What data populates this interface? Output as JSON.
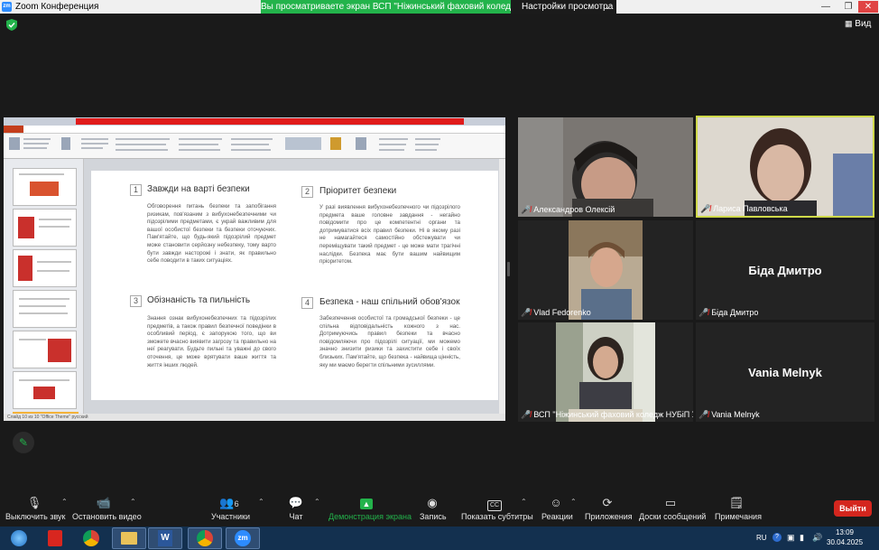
{
  "window": {
    "title": "Zoom Конференция",
    "share_banner": "Вы просматриваете экран ВСП \"Ніжинський фаховий коледж...",
    "view_settings": "Настройки просмотра",
    "view_label": "Вид"
  },
  "colors": {
    "share_green": "#23b34b",
    "leave_red": "#d4261e",
    "accent_blue": "#2d8cff",
    "mic_muted": "#e02828"
  },
  "slide": {
    "sections": [
      {
        "num": "1",
        "title": "Завжди на варті безпеки",
        "body": "Обговорення питань безпеки та запобігання ризикам, пов'язаним з вибухонебезпечними чи підозрілими предметами, є украй важливим для вашої особистої безпеки та безпеки оточуючих. Пам'ятайте, що будь-який підозрілий предмет може становити серйозну небезпеку, тому варто бути завжди насторожі і знати, як правильно себе поводити в таких ситуаціях."
      },
      {
        "num": "2",
        "title": "Пріоритет безпеки",
        "body": "У разі виявлення вибухонебезпечного чи підозрілого предмета ваше головне завдання - негайно повідомити про це компетентні органи та дотримуватися всіх правил безпеки. Ні в якому разі не намагайтеся самостійно обстежувати чи переміщувати такий предмет - це може мати трагічні наслідки. Безпека має бути вашим найвищим пріоритетом."
      },
      {
        "num": "3",
        "title": "Обізнаність та пильність",
        "body": "Знання ознак вибухонебезпечних та підозрілих предметів, а також правил безпечної поведінки в особливий період, є запорукою того, що ви зможете вчасно виявити загрозу та правильно на неї реагувати. Будьте пильні та уважні до свого оточення, це може врятувати ваше життя та життя інших людей."
      },
      {
        "num": "4",
        "title": "Безпека - наш спільний обов'язок",
        "body": "Забезпечення особистої та громадської безпеки - це спільна відповідальність кожного з нас. Дотримуючись правил безпеки та вчасно повідомляючи про підозрілі ситуації, ми можемо значно знизити ризики та захистити себе і своїх близьких. Пам'ятайте, що безпека - найвища цінність, яку ми маємо берегти спільними зусиллями."
      }
    ],
    "status": "Слайд 10 из 10   \"Office Theme\"   русский"
  },
  "participants": [
    {
      "name": "Александров Олексій",
      "muted": true,
      "video": true
    },
    {
      "name": "Лариса Павловська",
      "muted": true,
      "video": true,
      "speaking": true
    },
    {
      "name": "Vlad Fedorenko",
      "muted": true,
      "video": true
    },
    {
      "name": "Біда Дмитро",
      "muted": true,
      "video": false
    },
    {
      "name": "ВСП \"Ніжинський фаховий коледж НУБіП У...",
      "muted": true,
      "video": true
    },
    {
      "name": "Vania Melnyk",
      "muted": true,
      "video": false
    }
  ],
  "toolbar": {
    "mute": "Выключить звук",
    "video": "Остановить видео",
    "participants": "Участники",
    "participants_count": "6",
    "chat": "Чат",
    "share": "Демонстрация экрана",
    "record": "Запись",
    "captions": "Показать субтитры",
    "reactions": "Реакции",
    "apps": "Приложения",
    "whiteboards": "Доски сообщений",
    "notes": "Примечания",
    "leave": "Выйти"
  },
  "taskbar": {
    "lang": "RU",
    "time": "13:09",
    "date": "30.04.2025",
    "apps": [
      "windows-start",
      "acrobat",
      "chrome",
      "file-explorer",
      "word",
      "chrome-2",
      "zoom"
    ]
  }
}
